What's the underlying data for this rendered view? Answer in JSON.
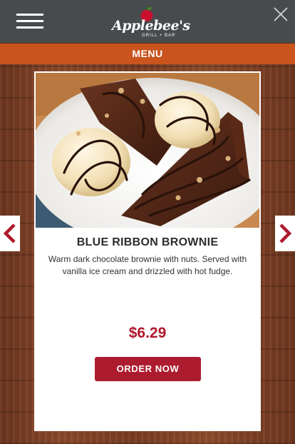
{
  "header": {
    "logo_text": "Applebee's",
    "logo_sub": "GRILL + BAR"
  },
  "menu_bar": {
    "label": "MENU"
  },
  "item": {
    "title": "BLUE RIBBON BROWNIE",
    "description": "Warm dark chocolate brownie with nuts. Served with vanilla ice cream and drizzled with hot fudge.",
    "price": "$6.29",
    "order_label": "ORDER NOW"
  },
  "colors": {
    "header_bg": "#474b4e",
    "menu_bar_bg": "#c9541e",
    "accent_red": "#b0152c",
    "button_red": "#ac1c2e"
  },
  "icons": {
    "menu": "hamburger-icon",
    "close": "close-icon",
    "prev": "chevron-left-icon",
    "next": "chevron-right-icon"
  }
}
